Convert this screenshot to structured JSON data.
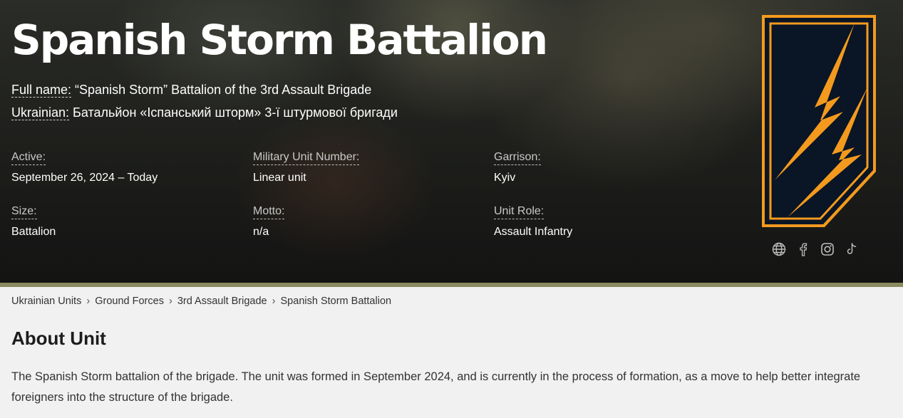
{
  "unit": {
    "title": "Spanish Storm Battalion",
    "full_name_label": "Full name:",
    "full_name_value": " “Spanish Storm” Battalion of the 3rd Assault Brigade",
    "ukrainian_label": "Ukrainian:",
    "ukrainian_value": " Батальйон «Іспанський шторм» 3-ї штурмової бригади"
  },
  "facts": {
    "active_label": "Active:",
    "active_value": "September 26, 2024 – Today",
    "unit_number_label": "Military Unit Number:",
    "unit_number_value": "Linear unit",
    "garrison_label": "Garrison:",
    "garrison_value": "Kyiv",
    "size_label": "Size:",
    "size_value": "Battalion",
    "motto_label": "Motto:",
    "motto_value": "n/a",
    "role_label": "Unit Role:",
    "role_value": "Assault Infantry"
  },
  "socials": [
    "globe-icon",
    "facebook-icon",
    "instagram-icon",
    "tiktok-icon"
  ],
  "colors": {
    "emblem_orange": "#f39a1e",
    "emblem_navy": "#0a1526",
    "hero_rule": "#8b8a61"
  },
  "breadcrumb": {
    "items": [
      "Ukrainian Units",
      "Ground Forces",
      "3rd Assault Brigade",
      "Spanish Storm Battalion"
    ],
    "separator": "›"
  },
  "about": {
    "heading": "About Unit",
    "text": "The Spanish Storm battalion of the brigade. The unit was formed in September 2024, and is currently in the process of formation, as a move to help better integrate foreigners into the structure of the brigade."
  }
}
